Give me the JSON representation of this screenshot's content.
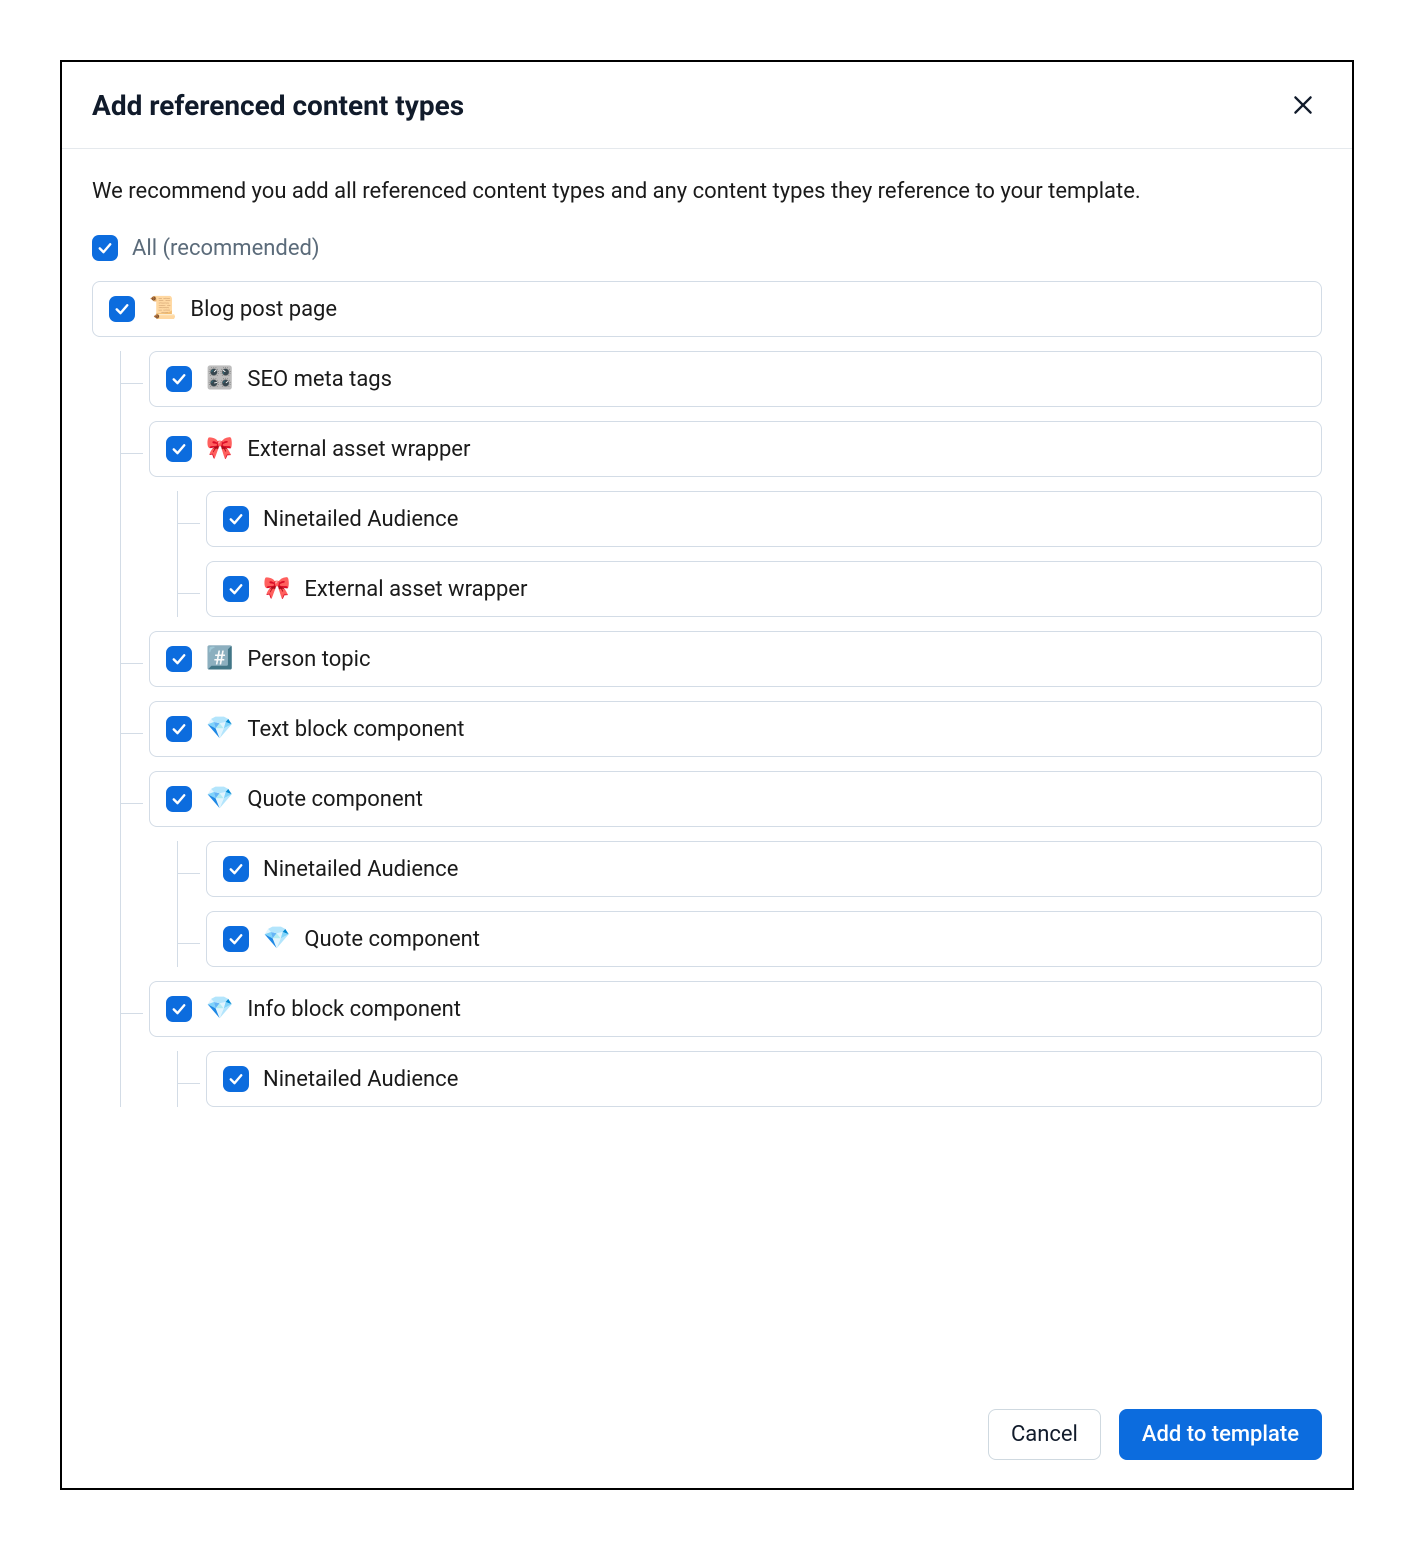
{
  "dialog": {
    "title": "Add referenced content types",
    "description": "We recommend you add all referenced content types and any content types they reference to your template.",
    "all_label": "All (recommended)",
    "all_checked": true,
    "cancel_label": "Cancel",
    "primary_label": "Add to template"
  },
  "tree": [
    {
      "emoji": "📜",
      "label": "Blog post page",
      "checked": true,
      "children": [
        {
          "emoji": "🎛️",
          "label": "SEO meta tags",
          "checked": true
        },
        {
          "emoji": "🎀",
          "label": "External asset wrapper",
          "checked": true,
          "children": [
            {
              "emoji": "",
              "label": "Ninetailed Audience",
              "checked": true
            },
            {
              "emoji": "🎀",
              "label": "External asset wrapper",
              "checked": true
            }
          ]
        },
        {
          "emoji": "#️⃣",
          "label": "Person topic",
          "checked": true
        },
        {
          "emoji": "💎",
          "label": "Text block component",
          "checked": true
        },
        {
          "emoji": "💎",
          "label": "Quote component",
          "checked": true,
          "children": [
            {
              "emoji": "",
              "label": "Ninetailed Audience",
              "checked": true
            },
            {
              "emoji": "💎",
              "label": "Quote component",
              "checked": true
            }
          ]
        },
        {
          "emoji": "💎",
          "label": "Info block component",
          "checked": true,
          "children": [
            {
              "emoji": "",
              "label": "Ninetailed Audience",
              "checked": true
            }
          ]
        }
      ]
    }
  ]
}
